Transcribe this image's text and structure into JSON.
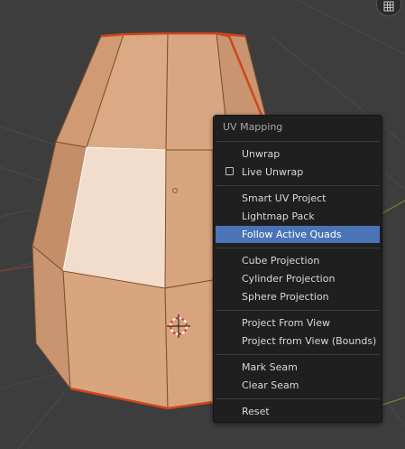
{
  "colors": {
    "viewport_bg": "#3d3d3d",
    "mesh_face": "#d8a57e",
    "mesh_edge": "#7a5230",
    "selected_face": "#f2ddcc",
    "boundary_edge": "#d0451b",
    "menu_bg": "#1f1f1f",
    "menu_highlight": "#4a74b5"
  },
  "viewport": {
    "top_right_icon": "grid-icon"
  },
  "menu": {
    "title": "UV Mapping",
    "items": [
      {
        "label": "Unwrap",
        "icon": null
      },
      {
        "label": "Live Unwrap",
        "icon": "checkbox-unchecked",
        "checked": false
      },
      {
        "label": "Smart UV Project",
        "icon": null
      },
      {
        "label": "Lightmap Pack",
        "icon": null
      },
      {
        "label": "Follow Active Quads",
        "icon": null,
        "highlighted": true
      },
      {
        "label": "Cube Projection",
        "icon": null
      },
      {
        "label": "Cylinder Projection",
        "icon": null
      },
      {
        "label": "Sphere Projection",
        "icon": null
      },
      {
        "label": "Project From View",
        "icon": null
      },
      {
        "label": "Project from View (Bounds)",
        "icon": null
      },
      {
        "label": "Mark Seam",
        "icon": null
      },
      {
        "label": "Clear Seam",
        "icon": null
      },
      {
        "label": "Reset",
        "icon": null
      }
    ]
  }
}
